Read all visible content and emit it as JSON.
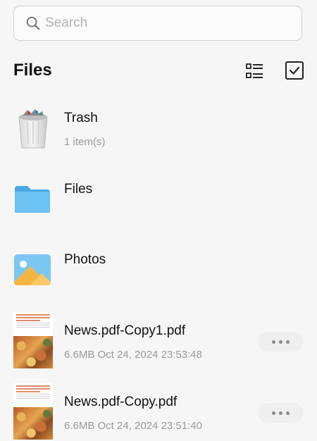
{
  "search": {
    "placeholder": "Search",
    "icon": "search-icon"
  },
  "header": {
    "title": "Files",
    "list_view_icon": "list-view-icon",
    "select_icon": "select-checkbox-icon"
  },
  "items": [
    {
      "name": "Trash",
      "meta": "1 item(s)",
      "icon": "trash-bin-icon"
    },
    {
      "name": "Files",
      "icon": "folder-icon"
    },
    {
      "name": "Photos",
      "icon": "photo-album-icon"
    },
    {
      "name": "News.pdf-Copy1.pdf",
      "meta": "6.6MB Oct 24, 2024 23:53:48",
      "icon": "pdf-thumbnail"
    },
    {
      "name": "News.pdf-Copy.pdf",
      "meta": "6.6MB Oct 24, 2024 23:51:40",
      "icon": "pdf-thumbnail"
    }
  ],
  "colors": {
    "background": "#f6f6f6",
    "folder": "#5bb8ef",
    "photo_sky": "#7cc6f2",
    "photo_sun": "#f5b541"
  }
}
